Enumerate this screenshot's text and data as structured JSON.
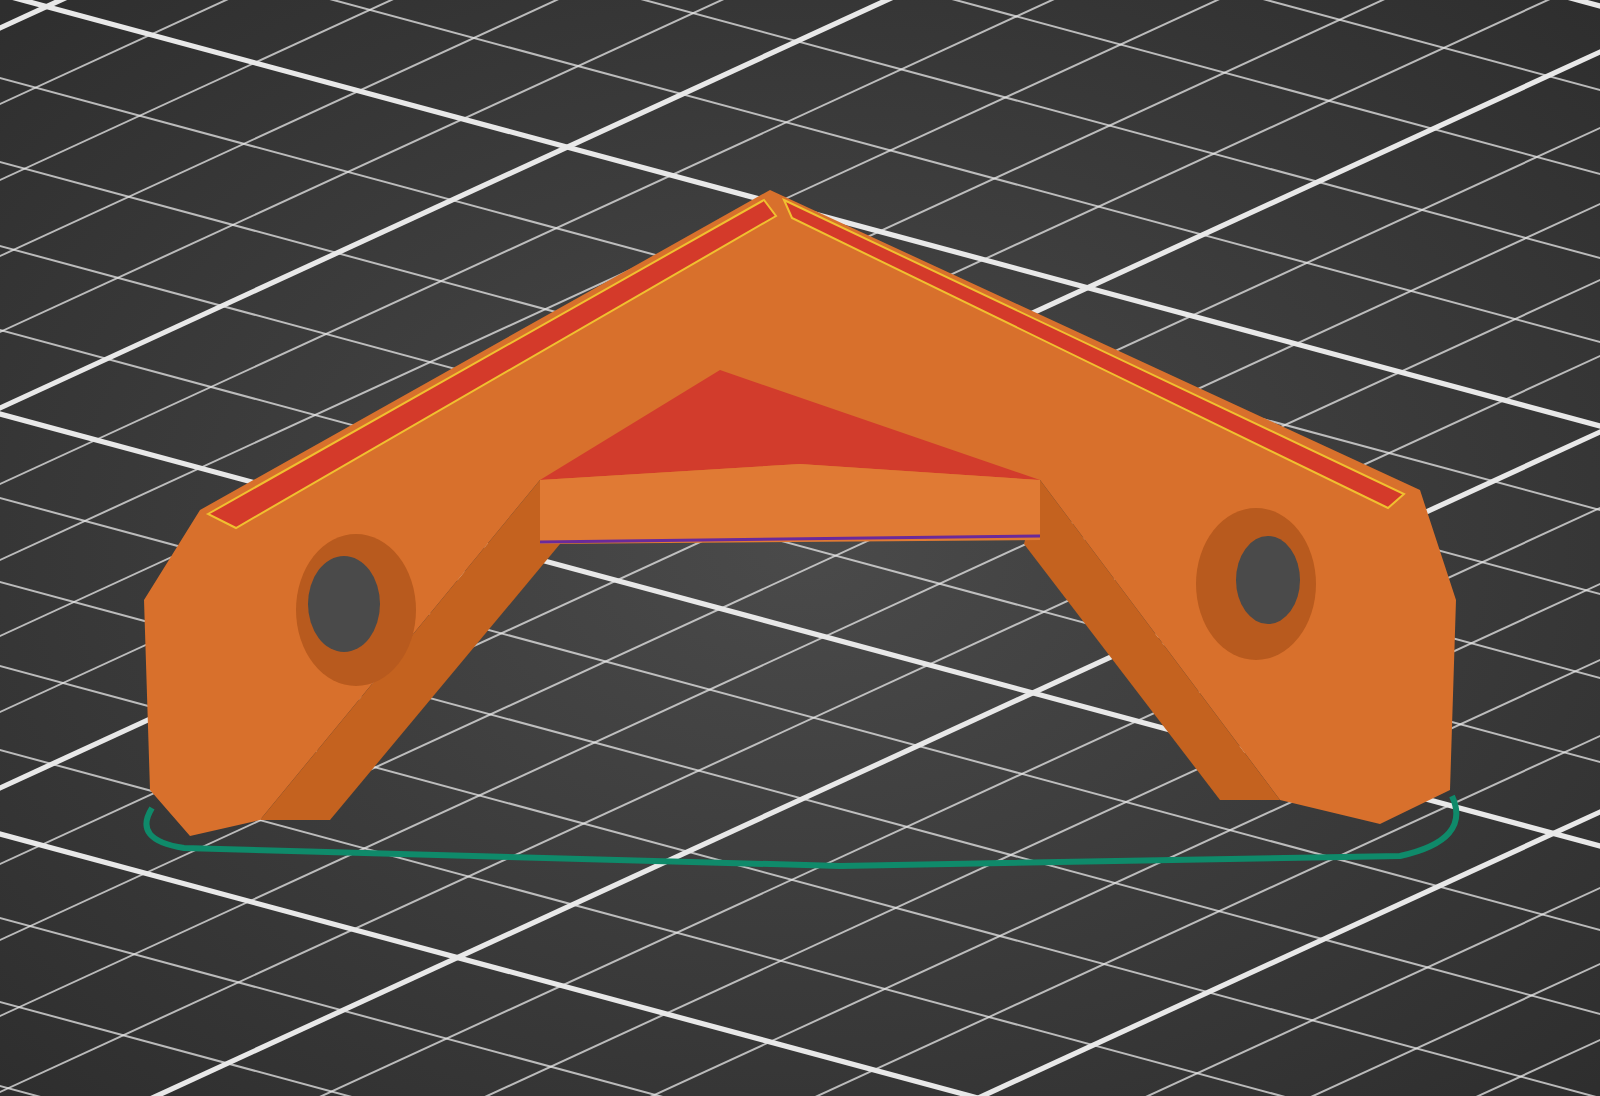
{
  "viewport": {
    "grid": true,
    "skirt": true
  }
}
